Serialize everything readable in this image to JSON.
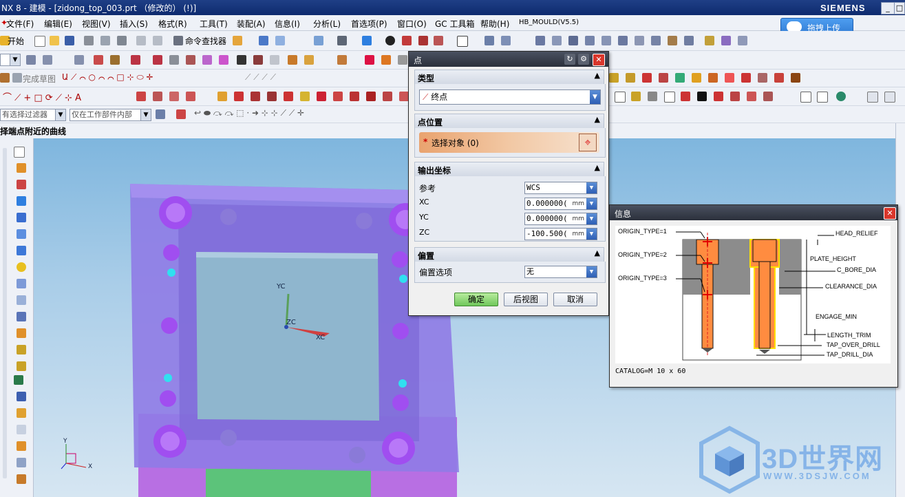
{
  "window": {
    "title": "NX 8 - 建模 - [zidong_top_003.prt （修改的）   (!)]",
    "brand": "SIEMENS",
    "min": "_",
    "max": "□"
  },
  "menu": [
    "文件(F)",
    "编辑(E)",
    "视图(V)",
    "插入(S)",
    "格式(R)",
    "工具(T)",
    "装配(A)",
    "信息(I)",
    "分析(L)",
    "首选项(P)",
    "窗口(O)",
    "GC 工具箱",
    "帮助(H)",
    "HB_MOULD(V5.5)"
  ],
  "upload_button": "拖拽上传",
  "toolbar1": {
    "start": "开始",
    "command_finder": "命令查找器"
  },
  "toolbar3": {
    "finish_sketch": "完成草图"
  },
  "filters": {
    "selection_filter": "有选择过滤器",
    "scope": "仅在工作部件内部"
  },
  "cue_line": "择端点附近的曲线",
  "viewport": {
    "triad": {
      "xc": "XC",
      "yc": "YC",
      "zc": "ZC"
    },
    "corner": {
      "x": "X",
      "y": "Y"
    },
    "colors": {
      "plate": "#8f6fe8",
      "cavity": "#8fb6ce",
      "bolt": "#a04ef0",
      "pin": "#30e0f0"
    }
  },
  "point_dialog": {
    "title": "点",
    "type_section": "类型",
    "type_value": "终点",
    "location_section": "点位置",
    "select_object": "选择对象 (0)",
    "output_section": "输出坐标",
    "reference_label": "参考",
    "reference_value": "WCS",
    "xc_label": "XC",
    "xc_value": "0.000000(",
    "yc_label": "YC",
    "yc_value": "0.000000(",
    "zc_label": "ZC",
    "zc_value": "-100.500(",
    "unit": "mm",
    "offset_section": "偏置",
    "offset_label": "偏置选项",
    "offset_value": "无",
    "ok": "确定",
    "back": "后视图",
    "cancel": "取消"
  },
  "info_dialog": {
    "title": "信息",
    "labels": {
      "origin1": "ORIGIN_TYPE=1",
      "origin2": "ORIGIN_TYPE=2",
      "origin3": "ORIGIN_TYPE=3",
      "head_relief": "HEAD_RELIEF",
      "plate_height": "PLATE_HEIGHT",
      "c_bore_dia": "C_BORE_DIA",
      "clearance_dia": "CLEARANCE_DIA",
      "engage_min": "ENGAGE_MIN",
      "length_trim": "LENGTH_TRIM",
      "tap_over_drill": "TAP_OVER_DRILL",
      "tap_drill_dia": "TAP_DRILL_DIA"
    },
    "catalog": "CATALOG=M 10 x 60"
  },
  "watermark": {
    "brand": "3D世界网",
    "url": "WWW.3DSJW.COM"
  }
}
